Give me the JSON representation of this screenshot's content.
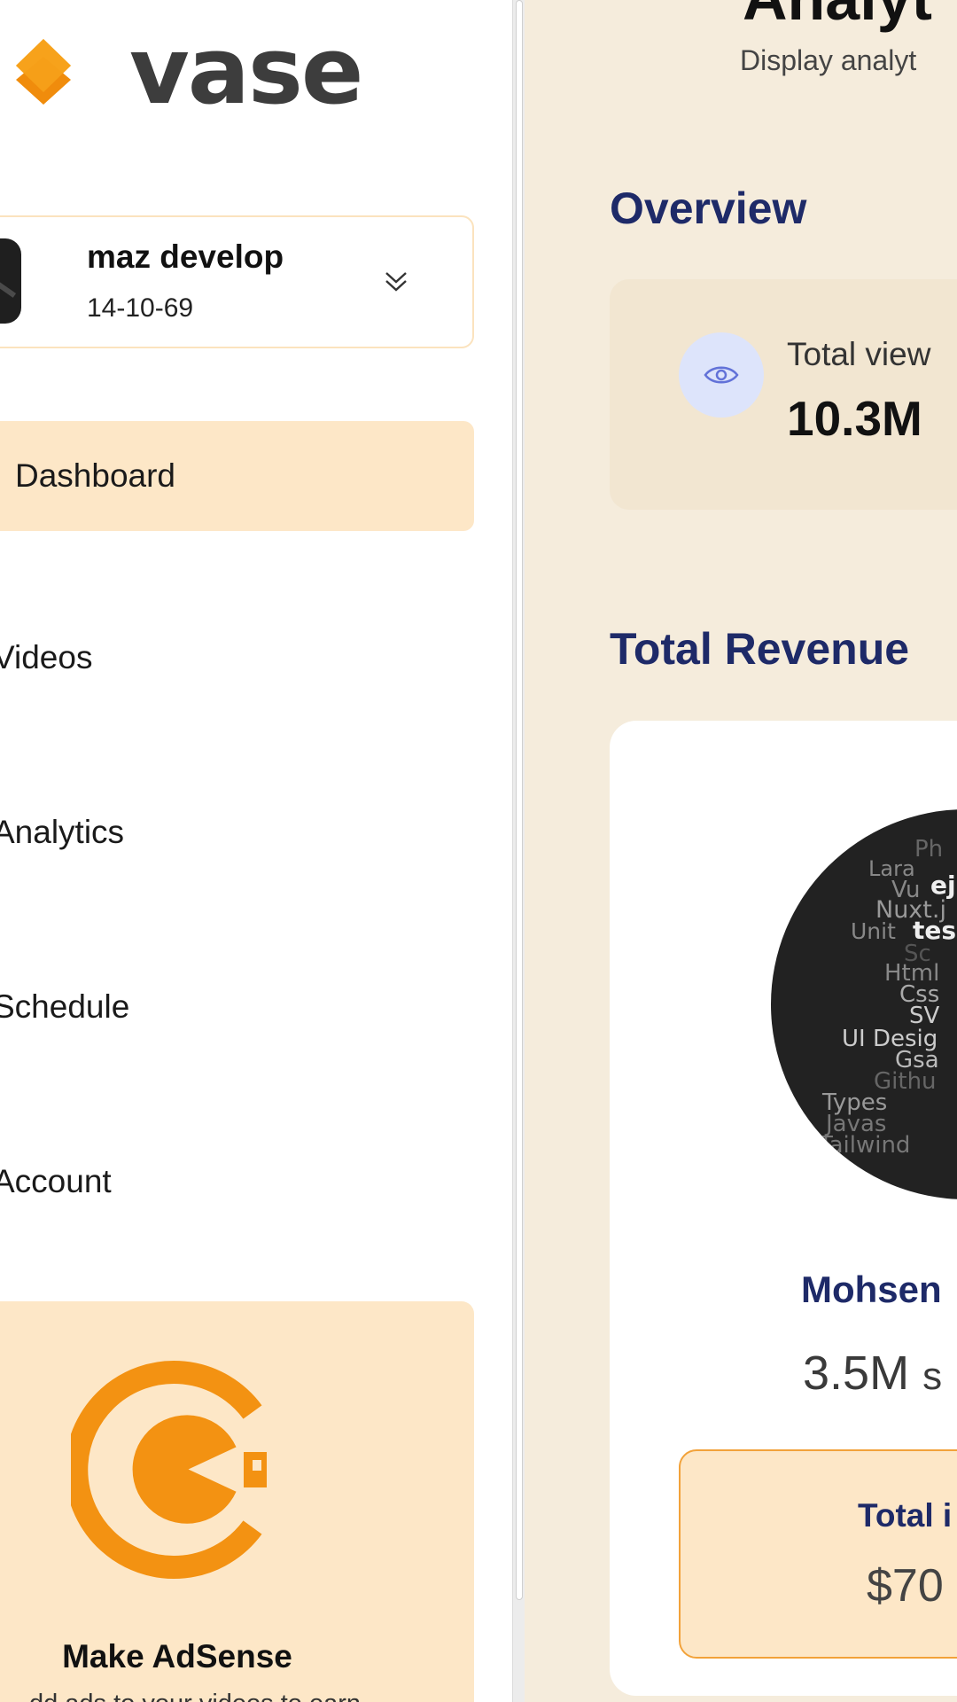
{
  "brand": {
    "name": "vase",
    "logo_icon": "diamond-logo-icon",
    "accent": "#f39212"
  },
  "profile": {
    "name": "maz develop",
    "date": "14-10-69",
    "expand_icon": "chevron-double-down-icon"
  },
  "nav": {
    "items": [
      {
        "label": "Dashboard",
        "active": true
      },
      {
        "label": "Videos"
      },
      {
        "label": "Analytics"
      },
      {
        "label": "Schedule"
      },
      {
        "label": "Account"
      }
    ]
  },
  "adsense": {
    "title": "Make AdSense",
    "subtitle": "dd ads to your videos to earn",
    "logo_icon": "adsense-logo-icon"
  },
  "page": {
    "title": "Analyt",
    "subtitle": "Display analyt"
  },
  "overview": {
    "title": "Overview",
    "total_views_label": "Total view",
    "total_views_value": "10.3M",
    "icon": "eye-icon"
  },
  "revenue": {
    "title": "Total Revenue",
    "channel_name": "Mohsen",
    "subscribers_value": "3.5M",
    "subscribers_unit": "s",
    "income_label": "Total i",
    "income_value": "$70",
    "cloud_words": [
      "Ph",
      "Lara",
      "Vu",
      "ej",
      "Nuxt.j",
      "Unit",
      "tes",
      "Sc",
      "Html",
      "Css",
      "SV",
      "UI Desig",
      "Gsa",
      "Githu",
      "Types",
      "Javas",
      "Tailwind"
    ]
  },
  "colors": {
    "sidebar_bg": "#ffffff",
    "main_bg": "#f5ecdc",
    "active_bg": "#fde7c7",
    "heading": "#1e2a68"
  }
}
